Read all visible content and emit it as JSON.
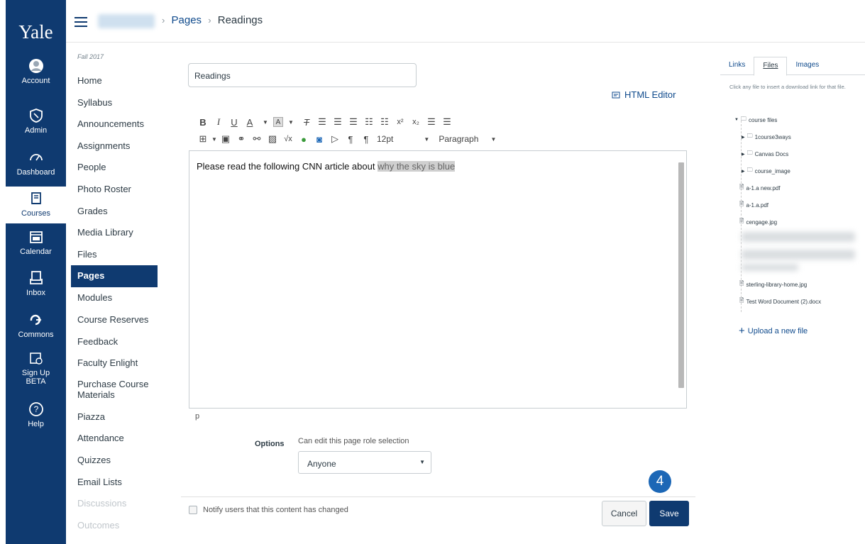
{
  "global_nav": {
    "logo": "Yale",
    "items": [
      {
        "label": "Account",
        "icon": "account-icon"
      },
      {
        "label": "Admin",
        "icon": "shield-icon"
      },
      {
        "label": "Dashboard",
        "icon": "dashboard-icon"
      },
      {
        "label": "Courses",
        "icon": "book-icon"
      },
      {
        "label": "Calendar",
        "icon": "calendar-icon"
      },
      {
        "label": "Inbox",
        "icon": "inbox-icon"
      },
      {
        "label": "Commons",
        "icon": "commons-icon"
      },
      {
        "label": "Sign Up",
        "label2": "BETA",
        "icon": "signup-calendar-icon"
      },
      {
        "label": "Help",
        "icon": "help-icon"
      }
    ]
  },
  "header": {
    "crumb_pages": "Pages",
    "crumb_current": "Readings",
    "separator": "›"
  },
  "course_nav": {
    "term": "Fall 2017",
    "items": [
      "Home",
      "Syllabus",
      "Announcements",
      "Assignments",
      "People",
      "Photo Roster",
      "Grades",
      "Media Library",
      "Files",
      "Pages",
      "Modules",
      "Course Reserves",
      "Feedback",
      "Faculty Enlight",
      "Purchase Course Materials",
      "Piazza",
      "Attendance",
      "Quizzes",
      "Email Lists",
      "Discussions",
      "Outcomes"
    ]
  },
  "editor": {
    "title_value": "Readings",
    "html_editor_label": "HTML Editor",
    "font_size": "12pt",
    "block_format": "Paragraph",
    "content_text": "Please read the following CNN article about ",
    "content_highlight": "why the sky is blue",
    "status_path": "p"
  },
  "options": {
    "label": "Options",
    "hint": "Can edit this page role selection",
    "selected": "Anyone"
  },
  "footer": {
    "notify_label": "Notify users that this content has changed",
    "cancel": "Cancel",
    "save": "Save",
    "step_badge": "4"
  },
  "sidebar": {
    "tabs": [
      "Links",
      "Files",
      "Images"
    ],
    "active_tab": "Files",
    "hint": "Click any file to insert a download link for that file.",
    "tree": {
      "root": "course files",
      "folders": [
        "1course3ways",
        "Canvas Docs",
        "course_image"
      ],
      "files_top": [
        "a-1.a new.pdf",
        "a-1.a.pdf",
        "cengage.jpg"
      ],
      "files_bottom": [
        "sterling-library-home.jpg",
        "Test Word Document (2).docx"
      ]
    },
    "upload": "Upload a new file"
  },
  "colors": {
    "nav_bg": "#0f3a70",
    "link": "#0f4a8c",
    "step_badge": "#1c67b6"
  }
}
